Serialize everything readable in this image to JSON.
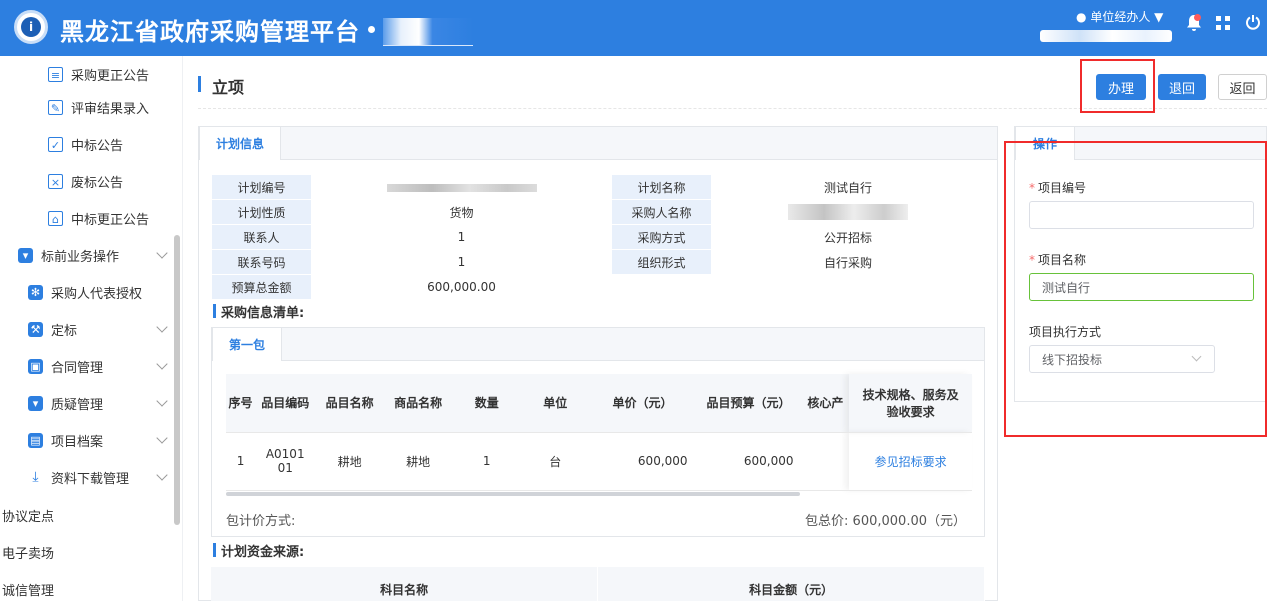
{
  "header": {
    "title": "黑龙江省政府采购管理平台",
    "user_role": "单位经办人 ▼"
  },
  "sidebar": {
    "items": [
      {
        "label": "采购更正公告",
        "icon": "document-edit-icon"
      },
      {
        "label": "评审结果录入",
        "icon": "edit-icon"
      },
      {
        "label": "中标公告",
        "icon": "check-doc-icon"
      },
      {
        "label": "废标公告",
        "icon": "close-doc-icon"
      },
      {
        "label": "中标更正公告",
        "icon": "house-doc-icon"
      },
      {
        "label": "标前业务操作",
        "icon": "cart-icon"
      },
      {
        "label": "采购人代表授权",
        "icon": "gear-icon"
      },
      {
        "label": "定标",
        "icon": "gavel-icon"
      },
      {
        "label": "合同管理",
        "icon": "lock-icon"
      },
      {
        "label": "质疑管理",
        "icon": "cart-icon"
      },
      {
        "label": "项目档案",
        "icon": "book-icon"
      },
      {
        "label": "资料下载管理",
        "icon": "download-icon"
      },
      {
        "label": "协议定点"
      },
      {
        "label": "电子卖场"
      },
      {
        "label": "诚信管理"
      }
    ]
  },
  "page": {
    "title": "立项",
    "actions": {
      "handle": "办理",
      "reject": "退回",
      "back": "返回"
    }
  },
  "plan": {
    "tab": "计划信息",
    "rows": [
      {
        "l1": "计划编号",
        "v1": "",
        "l2": "计划名称",
        "v2": "测试自行"
      },
      {
        "l1": "计划性质",
        "v1": "货物",
        "l2": "采购人名称",
        "v2": ""
      },
      {
        "l1": "联系人",
        "v1": "1",
        "l2": "采购方式",
        "v2": "公开招标"
      },
      {
        "l1": "联系号码",
        "v1": "1",
        "l2": "组织形式",
        "v2": "自行采购"
      },
      {
        "l1": "预算总金额",
        "v1": "600,000.00"
      }
    ]
  },
  "purchase_list": {
    "title": "采购信息清单:",
    "tab": "第一包",
    "columns": [
      "序号",
      "品目编码",
      "品目名称",
      "商品名称",
      "数量",
      "单位",
      "单价（元）",
      "品目预算（元）",
      "核心产",
      "技术规格、服务及验收要求"
    ],
    "row": {
      "index": "1",
      "code": "A010101",
      "category": "耕地",
      "product": "耕地",
      "qty": "1",
      "unit": "台",
      "price": "600,000",
      "budget": "600,000",
      "core": "",
      "link": "参见招标要求"
    },
    "pricing_label": "包计价方式:",
    "total_label": "包总价: 600,000.00（元）"
  },
  "fund": {
    "title": "计划资金来源:",
    "columns": [
      "科目名称",
      "科目金额（元）"
    ]
  },
  "operation": {
    "tab": "操作",
    "project_no_label": "项目编号",
    "project_no_value": "",
    "project_name_label": "项目名称",
    "project_name_value": "测试自行",
    "exec_label": "项目执行方式",
    "exec_value": "线下招投标"
  }
}
